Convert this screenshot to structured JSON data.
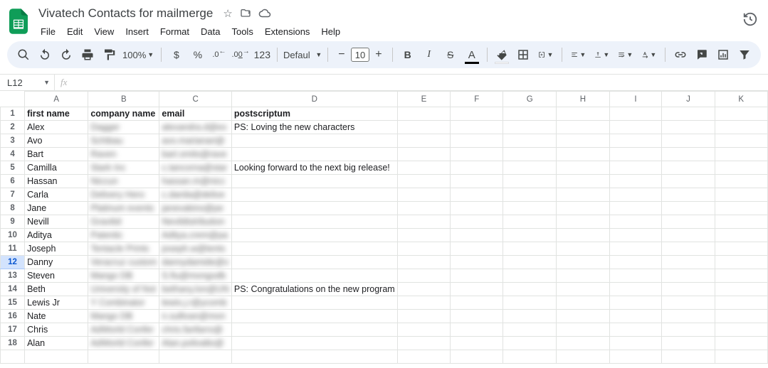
{
  "header": {
    "title": "Vivatech Contacts for mailmerge",
    "menus": [
      "File",
      "Edit",
      "View",
      "Insert",
      "Format",
      "Data",
      "Tools",
      "Extensions",
      "Help"
    ]
  },
  "toolbar": {
    "zoom": "100%",
    "currency": "$",
    "percent": "%",
    "dec_dec": ".0",
    "dec_inc": ".00",
    "numfmt": "123",
    "font_name": "Defaul…",
    "minus": "−",
    "font_size": "10",
    "plus": "+",
    "bold": "B",
    "italic": "I",
    "strike": "S",
    "textcolor": "A"
  },
  "namebox": {
    "value": "L12"
  },
  "columns": [
    "A",
    "B",
    "C",
    "D",
    "E",
    "F",
    "G",
    "H",
    "I",
    "J",
    "K"
  ],
  "sheet": {
    "headers": {
      "A": "first name",
      "B": "company name",
      "C": "email",
      "D": "postscriptum"
    },
    "rows": [
      {
        "n": 1,
        "header": true,
        "A": "first name",
        "B": "company name",
        "C": "email",
        "D": "postscriptum"
      },
      {
        "n": 2,
        "A": "Alex",
        "B": "Dagger",
        "C": "alexandra.d@ex",
        "D": "PS: Loving the new characters"
      },
      {
        "n": 3,
        "A": "Avo",
        "B": "Schibau",
        "C": "avo.marianari@",
        "D": ""
      },
      {
        "n": 4,
        "A": "Bart",
        "B": "Raven",
        "C": "bart.smits@rave",
        "D": ""
      },
      {
        "n": 5,
        "A": "Camilla",
        "B": "Stark Inc",
        "C": "c.tancorna@star",
        "D": "Looking forward to the next big release!"
      },
      {
        "n": 6,
        "A": "Hassan",
        "B": "Niccun",
        "C": "hassan.m@nicc",
        "D": ""
      },
      {
        "n": 7,
        "A": "Carla",
        "B": "Delivery Hero",
        "C": "c.danila@delive",
        "D": ""
      },
      {
        "n": 8,
        "A": "Jane",
        "B": "Platinum events",
        "C": "janevakino@pe",
        "D": ""
      },
      {
        "n": 9,
        "A": "Nevill",
        "B": "Gravitid",
        "C": "Nevildistribution",
        "D": ""
      },
      {
        "n": 10,
        "A": "Aditya",
        "B": "Patentic",
        "C": "Aditya.crem@pa",
        "D": ""
      },
      {
        "n": 11,
        "A": "Joseph",
        "B": "Tentacle Prints",
        "C": "joseph.w@tents",
        "D": ""
      },
      {
        "n": 12,
        "A": "Danny",
        "B": "Veracruz custom",
        "C": "dannydamide@v",
        "D": "",
        "selected": true
      },
      {
        "n": 13,
        "A": "Steven",
        "B": "Mango DB",
        "C": "S.fiu@mongodb",
        "D": ""
      },
      {
        "n": 14,
        "A": "Beth",
        "B": "University of Not",
        "C": "bethany.lon@UN",
        "D": "PS: Congratulations on the new program"
      },
      {
        "n": 15,
        "A": "Lewis Jr",
        "B": "Y Combinator",
        "C": "lewis.j.r@ycomb",
        "D": ""
      },
      {
        "n": 16,
        "A": "Nate",
        "B": "Mango DB",
        "C": "n.sullivan@mon",
        "D": ""
      },
      {
        "n": 17,
        "A": "Chris",
        "B": "AdWorld Confer",
        "C": "chris.fanfarro@",
        "D": ""
      },
      {
        "n": 18,
        "A": "Alan",
        "B": "AdWorld Confer",
        "C": "Alan.polivalto@",
        "D": ""
      }
    ]
  }
}
